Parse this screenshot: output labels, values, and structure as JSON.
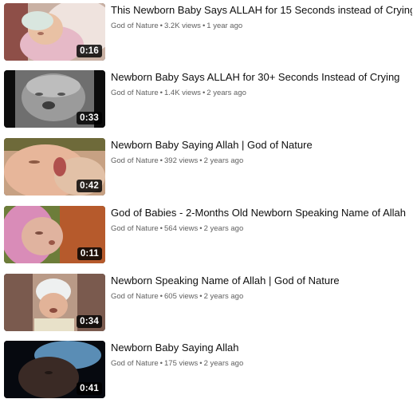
{
  "videos": [
    {
      "title": "This Newborn Baby Says ALLAH for 15 Seconds instead of Crying",
      "channel": "God of Nature",
      "views": "3.2K views",
      "age": "1 year ago",
      "duration": "0:16",
      "thumb_colors": {
        "bg": "#c9b1a4",
        "accent": "#e6b9c7",
        "skin": "#e9c1a4"
      }
    },
    {
      "title": "Newborn Baby Says ALLAH for 30+ Seconds Instead of Crying",
      "channel": "God of Nature",
      "views": "1.4K views",
      "age": "2 years ago",
      "duration": "0:33",
      "thumb_colors": {
        "bg": "#111111",
        "accent": "#8a8a8a",
        "skin": "#9b9b9b"
      }
    },
    {
      "title": "Newborn Baby Saying Allah | God of Nature",
      "channel": "God of Nature",
      "views": "392 views",
      "age": "2 years ago",
      "duration": "0:42",
      "thumb_colors": {
        "bg": "#c8a184",
        "accent": "#dba58a",
        "skin": "#e7b69a"
      }
    },
    {
      "title": "God of Babies - 2-Months Old Newborn Speaking Name of Allah",
      "channel": "God of Nature",
      "views": "564 views",
      "age": "2 years ago",
      "duration": "0:11",
      "thumb_colors": {
        "bg": "#6d7d3a",
        "accent": "#d98cb8",
        "skin": "#e0b39f"
      }
    },
    {
      "title": "Newborn Speaking Name of Allah | God of Nature",
      "channel": "God of Nature",
      "views": "605 views",
      "age": "2 years ago",
      "duration": "0:34",
      "thumb_colors": {
        "bg": "#7a5a4e",
        "accent": "#eef0f0",
        "skin": "#e2b398"
      }
    },
    {
      "title": "Newborn Baby Saying Allah",
      "channel": "God of Nature",
      "views": "175 views",
      "age": "2 years ago",
      "duration": "0:41",
      "thumb_colors": {
        "bg": "#06090f",
        "accent": "#5a8db5",
        "skin": "#3a2a25"
      }
    }
  ],
  "meta_separator": "•"
}
